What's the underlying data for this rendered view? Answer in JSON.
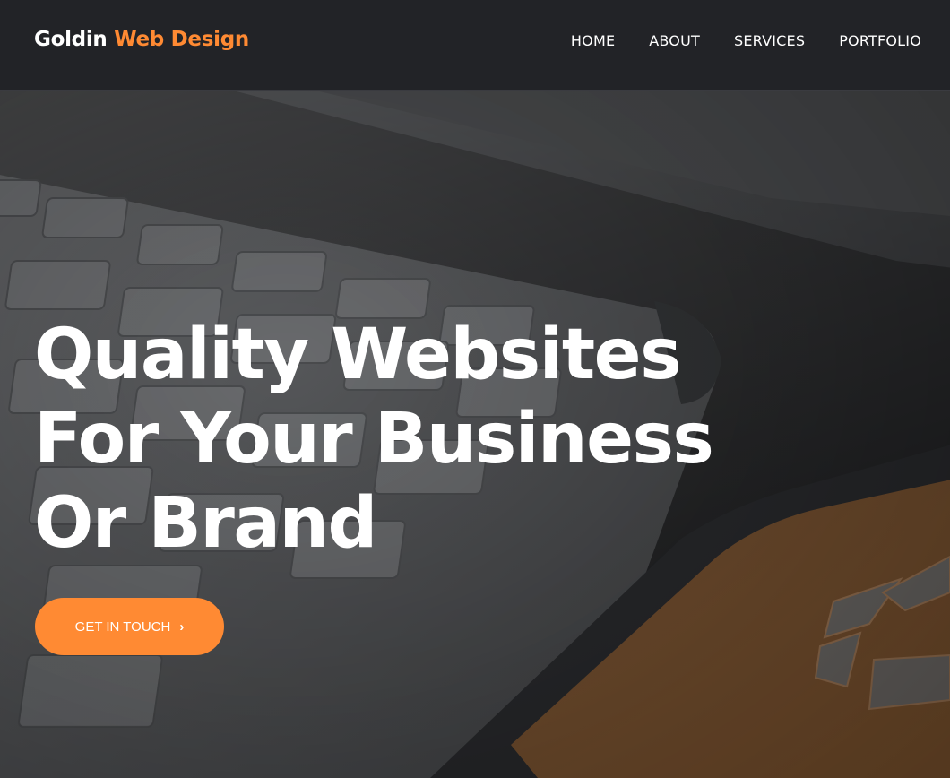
{
  "header": {
    "logo_main": "Goldin",
    "logo_accent": "Web Design",
    "nav": [
      {
        "label": "HOME"
      },
      {
        "label": "ABOUT"
      },
      {
        "label": "SERVICES"
      },
      {
        "label": "PORTFOLIO"
      }
    ]
  },
  "hero": {
    "headline_lines": [
      "Quality Websites",
      "For Your Business",
      "Or Brand"
    ],
    "cta_label": "GET IN TOUCH",
    "cta_icon": "chevron-right-icon"
  },
  "colors": {
    "accent": "#ff8a33",
    "header_bg": "#222327",
    "text": "#ffffff"
  }
}
